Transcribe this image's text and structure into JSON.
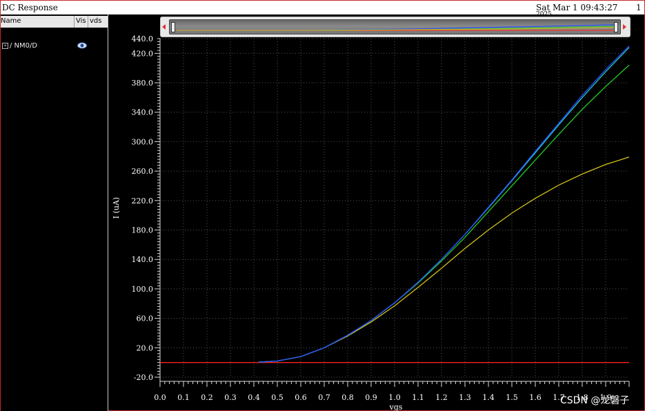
{
  "window": {
    "title": "DC Response",
    "datetime": "Sat Mar 1 09:43:27",
    "datetime_overflow": "2025",
    "subwindow_number": "1"
  },
  "sidebar": {
    "columns": [
      "Name",
      "Vis",
      "vds"
    ],
    "signals": [
      {
        "name": "/ NM0/D",
        "expand_icon": "plus-box",
        "visibility_icon": "eye"
      }
    ]
  },
  "watermark": "CSDN @龙磐子",
  "colors": {
    "background": "#000000",
    "frame": "#c62828",
    "series_red": "#ff2020",
    "series_yellow": "#d4c21a",
    "series_green": "#22cc22",
    "series_cyan": "#22cccc",
    "series_blue": "#2a4dff"
  },
  "chart_data": {
    "type": "line",
    "title": "",
    "xlabel": "vgs",
    "ylabel": "I (uA)",
    "xlim": [
      0.0,
      2.0
    ],
    "ylim": [
      -20.0,
      440.0
    ],
    "x_ticks": [
      "0.0",
      "0.1",
      "0.2",
      "0.3",
      "0.4",
      "0.5",
      "0.6",
      "0.7",
      "0.8",
      "0.9",
      "1.0",
      "1.1",
      "1.2",
      "1.3",
      "1.4",
      "1.5",
      "1.6",
      "1.7",
      "1.8",
      "1.9"
    ],
    "y_ticks": [
      "-20.0",
      "20.0",
      "60.0",
      "100.0",
      "140.0",
      "180.0",
      "220.0",
      "260.0",
      "300.0",
      "340.0",
      "380.0",
      "420.0",
      "440.0"
    ],
    "grid": true,
    "legend": "none",
    "series": [
      {
        "color": "#ff2020",
        "x": [
          0.0,
          2.0
        ],
        "y": [
          0.0,
          0.0
        ]
      },
      {
        "color": "#d4c21a",
        "x": [
          0.42,
          0.5,
          0.6,
          0.7,
          0.8,
          0.9,
          1.0,
          1.1,
          1.2,
          1.3,
          1.4,
          1.5,
          1.6,
          1.7,
          1.8,
          1.9,
          2.0
        ],
        "y": [
          0.5,
          2,
          8,
          20,
          36,
          55,
          77,
          102,
          128,
          155,
          180,
          203,
          223,
          241,
          256,
          269,
          279
        ]
      },
      {
        "color": "#22cc22",
        "x": [
          0.42,
          0.5,
          0.6,
          0.7,
          0.8,
          0.9,
          1.0,
          1.1,
          1.2,
          1.3,
          1.4,
          1.5,
          1.6,
          1.7,
          1.8,
          1.9,
          2.0
        ],
        "y": [
          0.5,
          2,
          8,
          20,
          37,
          57,
          81,
          108,
          138,
          170,
          205,
          240,
          275,
          310,
          344,
          375,
          404
        ]
      },
      {
        "color": "#22cccc",
        "x": [
          0.42,
          0.5,
          0.6,
          0.7,
          0.8,
          0.9,
          1.0,
          1.1,
          1.2,
          1.3,
          1.4,
          1.5,
          1.6,
          1.7,
          1.8,
          1.9,
          2.0
        ],
        "y": [
          0.5,
          2,
          8,
          20,
          37,
          57,
          81,
          109,
          140,
          174,
          210,
          247,
          285,
          323,
          360,
          395,
          428
        ]
      },
      {
        "color": "#2a4dff",
        "x": [
          0.42,
          0.5,
          0.6,
          0.7,
          0.8,
          0.9,
          1.0,
          1.1,
          1.2,
          1.3,
          1.4,
          1.5,
          1.6,
          1.7,
          1.8,
          1.9,
          2.0
        ],
        "y": [
          0.5,
          2,
          8,
          20,
          37,
          57,
          81,
          109,
          140,
          174,
          211,
          248,
          287,
          325,
          363,
          398,
          430
        ]
      }
    ]
  }
}
